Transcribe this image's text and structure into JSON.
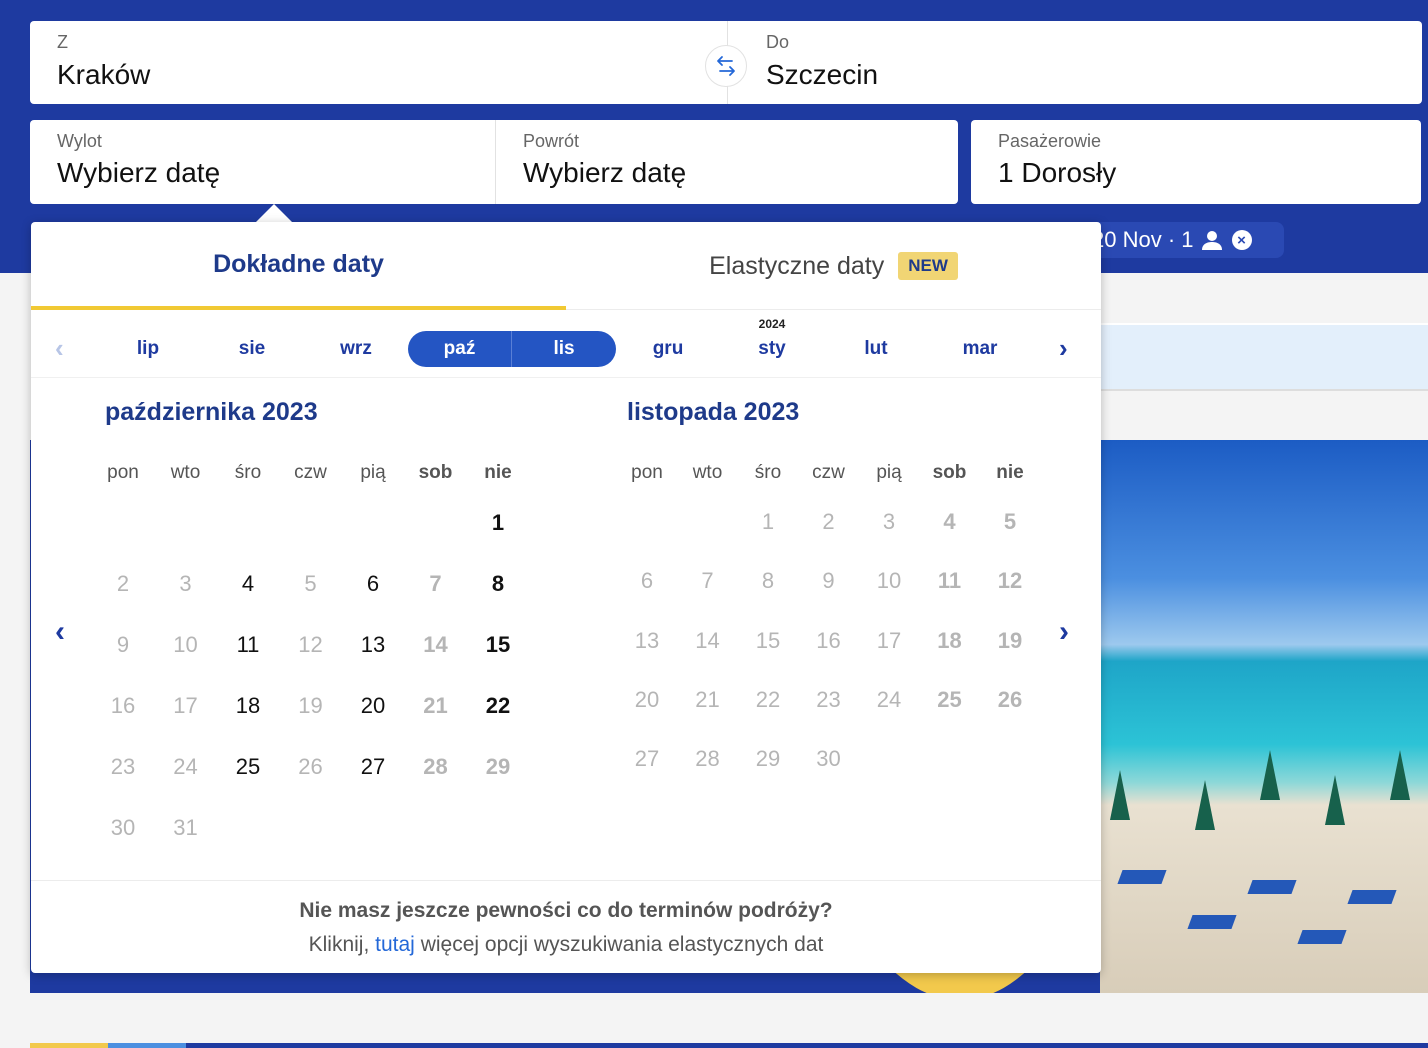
{
  "search": {
    "from_label": "Z",
    "from_value": "Kraków",
    "to_label": "Do",
    "to_value": "Szczecin",
    "depart_label": "Wylot",
    "depart_value": "Wybierz datę",
    "return_label": "Powrót",
    "return_value": "Wybierz datę",
    "pax_label": "Pasażerowie",
    "pax_value": "1 Dorosły",
    "recent_chip": "20 Nov · 1"
  },
  "calendar": {
    "tabs": {
      "exact": "Dokładne daty",
      "flexible": "Elastyczne daty",
      "new_badge": "NEW"
    },
    "months_strip": [
      "lip",
      "sie",
      "wrz",
      "paź",
      "lis",
      "gru",
      "sty",
      "lut",
      "mar"
    ],
    "year_marker": "2024",
    "weekdays": [
      "pon",
      "wto",
      "śro",
      "czw",
      "pią",
      "sob",
      "nie"
    ],
    "month1": {
      "title": "października 2023",
      "days": [
        "1",
        "2",
        "3",
        "4",
        "5",
        "6",
        "7",
        "8",
        "9",
        "10",
        "11",
        "12",
        "13",
        "14",
        "15",
        "16",
        "17",
        "18",
        "19",
        "20",
        "21",
        "22",
        "23",
        "24",
        "25",
        "26",
        "27",
        "28",
        "29",
        "30",
        "31"
      ],
      "available": [
        "1",
        "4",
        "6",
        "8",
        "11",
        "13",
        "15",
        "18",
        "20",
        "22",
        "25",
        "27"
      ]
    },
    "month2": {
      "title": "listopada 2023",
      "days": [
        "1",
        "2",
        "3",
        "4",
        "5",
        "6",
        "7",
        "8",
        "9",
        "10",
        "11",
        "12",
        "13",
        "14",
        "15",
        "16",
        "17",
        "18",
        "19",
        "20",
        "21",
        "22",
        "23",
        "24",
        "25",
        "26",
        "27",
        "28",
        "29",
        "30"
      ],
      "available": []
    },
    "footer_question": "Nie masz jeszcze pewności co do terminów podróży?",
    "footer_prefix": "Kliknij, ",
    "footer_link": "tutaj",
    "footer_suffix": " więcej opcji wyszukiwania elastycznych dat"
  },
  "icons": {
    "swap": "swap-arrows-icon",
    "person": "person-icon",
    "close": "close-circle-icon",
    "prev": "chevron-left-icon",
    "next": "chevron-right-icon"
  },
  "colors": {
    "brand_blue": "#1e3aa0",
    "accent_yellow": "#f1c933",
    "selected_blue": "#2455c3",
    "link_blue": "#2468d8"
  }
}
